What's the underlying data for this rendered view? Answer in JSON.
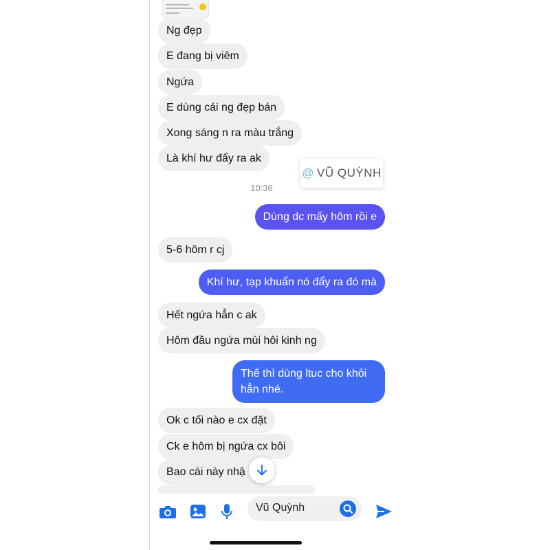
{
  "colors": {
    "incoming_bg": "#efefef",
    "outgoing_purple": "#5b53f0",
    "outgoing_blue": "#3f6cf3",
    "accent": "#1f6fe8"
  },
  "watermark": {
    "icon": "at-icon",
    "text": "VŨ QUỲNH"
  },
  "timestamp": "10:36",
  "messages": [
    {
      "text": "Ng đẹp"
    },
    {
      "text": "E đang bị viêm"
    },
    {
      "text": "Ngứa"
    },
    {
      "text": "E dùng cái ng đẹp bán"
    },
    {
      "text": "Xong sáng n ra màu trắng"
    },
    {
      "text": "Là khí hư đẩy ra ak"
    },
    {
      "text": "Dùng dc mấy hôm rồi e"
    },
    {
      "text": "5-6 hôm r cj"
    },
    {
      "text": "Khí hư, tạp khuẩn nó đẩy ra đó mà"
    },
    {
      "text": "Hết ngứa hẳn c ak"
    },
    {
      "text": "Hôm đầu ngứa mùi hôi kinh ng"
    },
    {
      "text": "Thế thì dùng ltuc cho khỏi\nhẳn nhé."
    },
    {
      "text": "Ok c tối nào e cx đặt"
    },
    {
      "text": "Ck e hôm bị ngứa cx bôi"
    },
    {
      "text": "Bao cái này nhậ"
    }
  ],
  "composer": {
    "value": "Vũ Quỳnh",
    "icons": [
      "camera-icon",
      "photo-icon",
      "microphone-icon",
      "emoji-icon",
      "send-icon"
    ]
  }
}
